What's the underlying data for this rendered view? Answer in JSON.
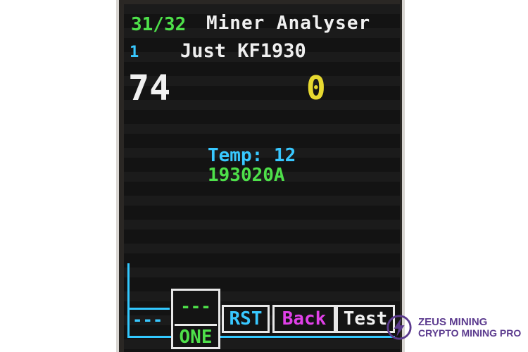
{
  "header": {
    "progress": "31/32",
    "title": "Miner Analyser"
  },
  "info": {
    "chain_index": "1",
    "chip_model": "Just KF1930"
  },
  "counters": {
    "left_value": "74",
    "right_value": "0"
  },
  "status": {
    "temp": "Temp: 12",
    "date_code": "193020A"
  },
  "softkeys": {
    "dashes_left": "---",
    "one_dashes": "---",
    "one_label": "ONE",
    "rst": "RST",
    "back": "Back",
    "test": "Test"
  },
  "watermark": {
    "line1": "ZEUS MINING",
    "line2": "CRYPTO MINING PRO",
    "icon": "lightning-bolt-icon"
  },
  "colors": {
    "green": "#4ee04a",
    "white": "#f0f0f0",
    "cyan": "#38c8ff",
    "yellow": "#e6d830",
    "magenta": "#e040e8",
    "brand_purple": "#5b3a8e"
  }
}
